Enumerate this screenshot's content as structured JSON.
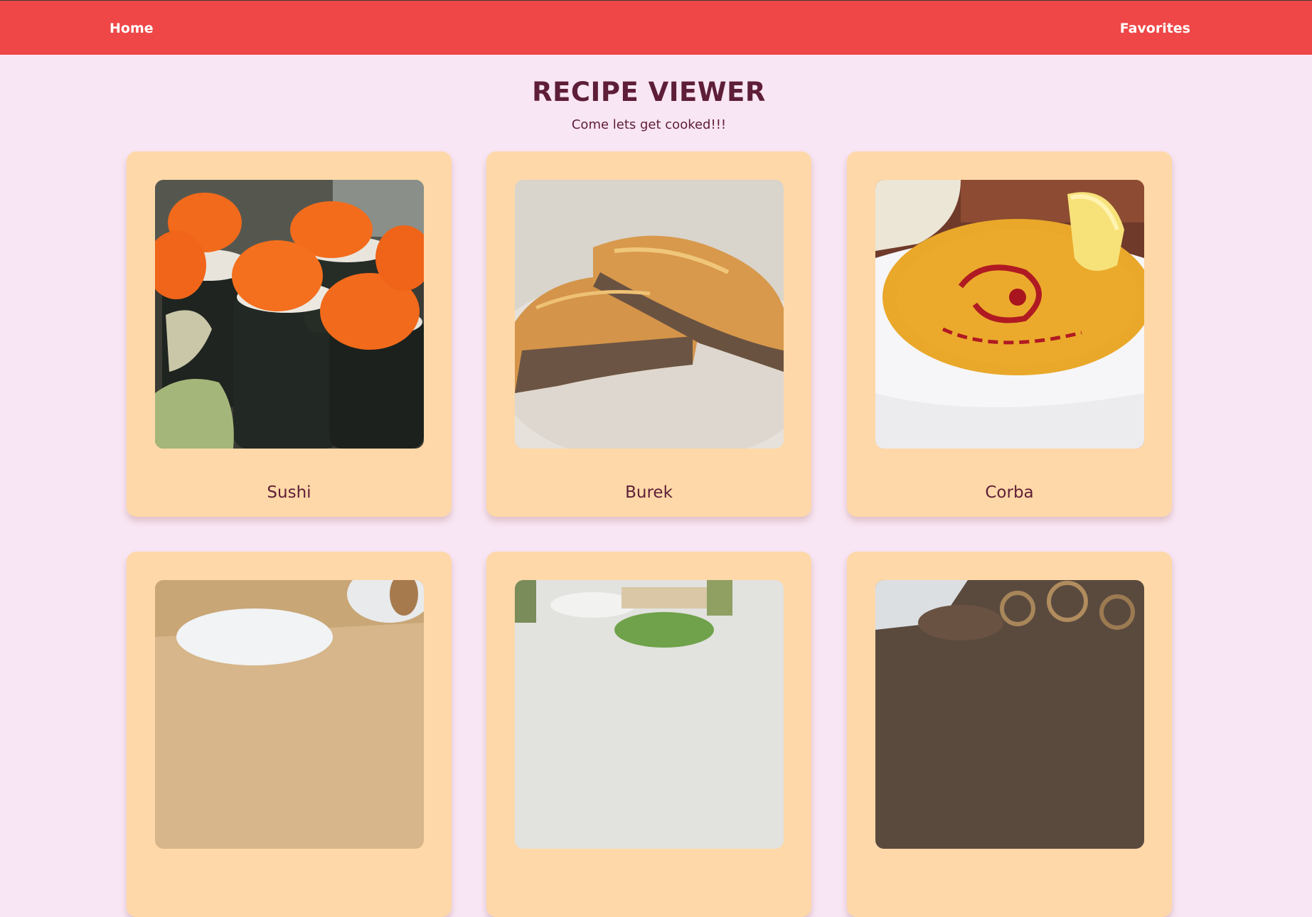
{
  "nav": {
    "home_label": "Home",
    "favorites_label": "Favorites"
  },
  "header": {
    "title": "RECIPE VIEWER",
    "subtitle": "Come lets get cooked!!!"
  },
  "recipes": [
    {
      "name": "Sushi",
      "image": "sushi-photo"
    },
    {
      "name": "Burek",
      "image": "burek-photo"
    },
    {
      "name": "Corba",
      "image": "corba-soup-photo"
    },
    {
      "name": "",
      "image": "recipe-photo-partial"
    },
    {
      "name": "",
      "image": "recipe-photo-partial"
    },
    {
      "name": "",
      "image": "recipe-photo-partial"
    }
  ],
  "colors": {
    "navbar": "#ef4647",
    "background": "#f9e6f4",
    "card": "#fed8a8",
    "title_text": "#5e1e37"
  }
}
